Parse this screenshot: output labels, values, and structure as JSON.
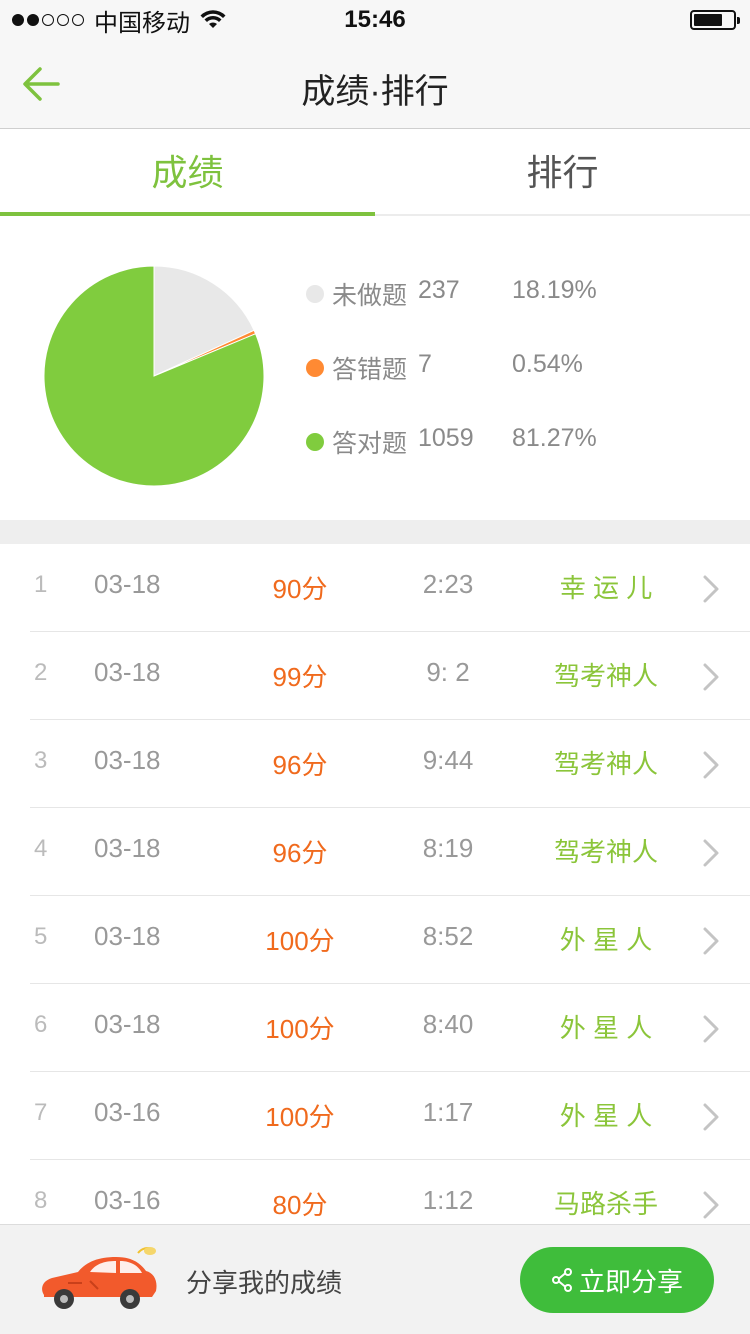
{
  "status_bar": {
    "carrier": "中国移动",
    "time": "15:46"
  },
  "nav": {
    "title": "成绩·排行"
  },
  "tabs": [
    {
      "label": "成绩",
      "active": true
    },
    {
      "label": "排行",
      "active": false
    }
  ],
  "summary": {
    "items": [
      {
        "label": "未做题",
        "count": "237",
        "percent": "18.19%",
        "color": "#e8e8e8",
        "fraction": 0.1819
      },
      {
        "label": "答错题",
        "count": "7",
        "percent": "0.54%",
        "color": "#ff8a33",
        "fraction": 0.0054
      },
      {
        "label": "答对题",
        "count": "1059",
        "percent": "81.27%",
        "color": "#80cc3e",
        "fraction": 0.8127
      }
    ]
  },
  "records": [
    {
      "index": "1",
      "date": "03-18",
      "score": "90分",
      "time": "2:23",
      "title": "幸 运 儿"
    },
    {
      "index": "2",
      "date": "03-18",
      "score": "99分",
      "time": "9: 2",
      "title": "驾考神人"
    },
    {
      "index": "3",
      "date": "03-18",
      "score": "96分",
      "time": "9:44",
      "title": "驾考神人"
    },
    {
      "index": "4",
      "date": "03-18",
      "score": "96分",
      "time": "8:19",
      "title": "驾考神人"
    },
    {
      "index": "5",
      "date": "03-18",
      "score": "100分",
      "time": "8:52",
      "title": "外 星 人"
    },
    {
      "index": "6",
      "date": "03-18",
      "score": "100分",
      "time": "8:40",
      "title": "外 星 人"
    },
    {
      "index": "7",
      "date": "03-16",
      "score": "100分",
      "time": "1:17",
      "title": "外 星 人"
    },
    {
      "index": "8",
      "date": "03-16",
      "score": "80分",
      "time": "1:12",
      "title": "马路杀手"
    }
  ],
  "footer": {
    "share_text": "分享我的成绩",
    "share_button": "立即分享"
  },
  "colors": {
    "accent": "#7ec23e",
    "score": "#f06a1d",
    "title": "#8bc53a",
    "share_button": "#3fbd3b"
  }
}
